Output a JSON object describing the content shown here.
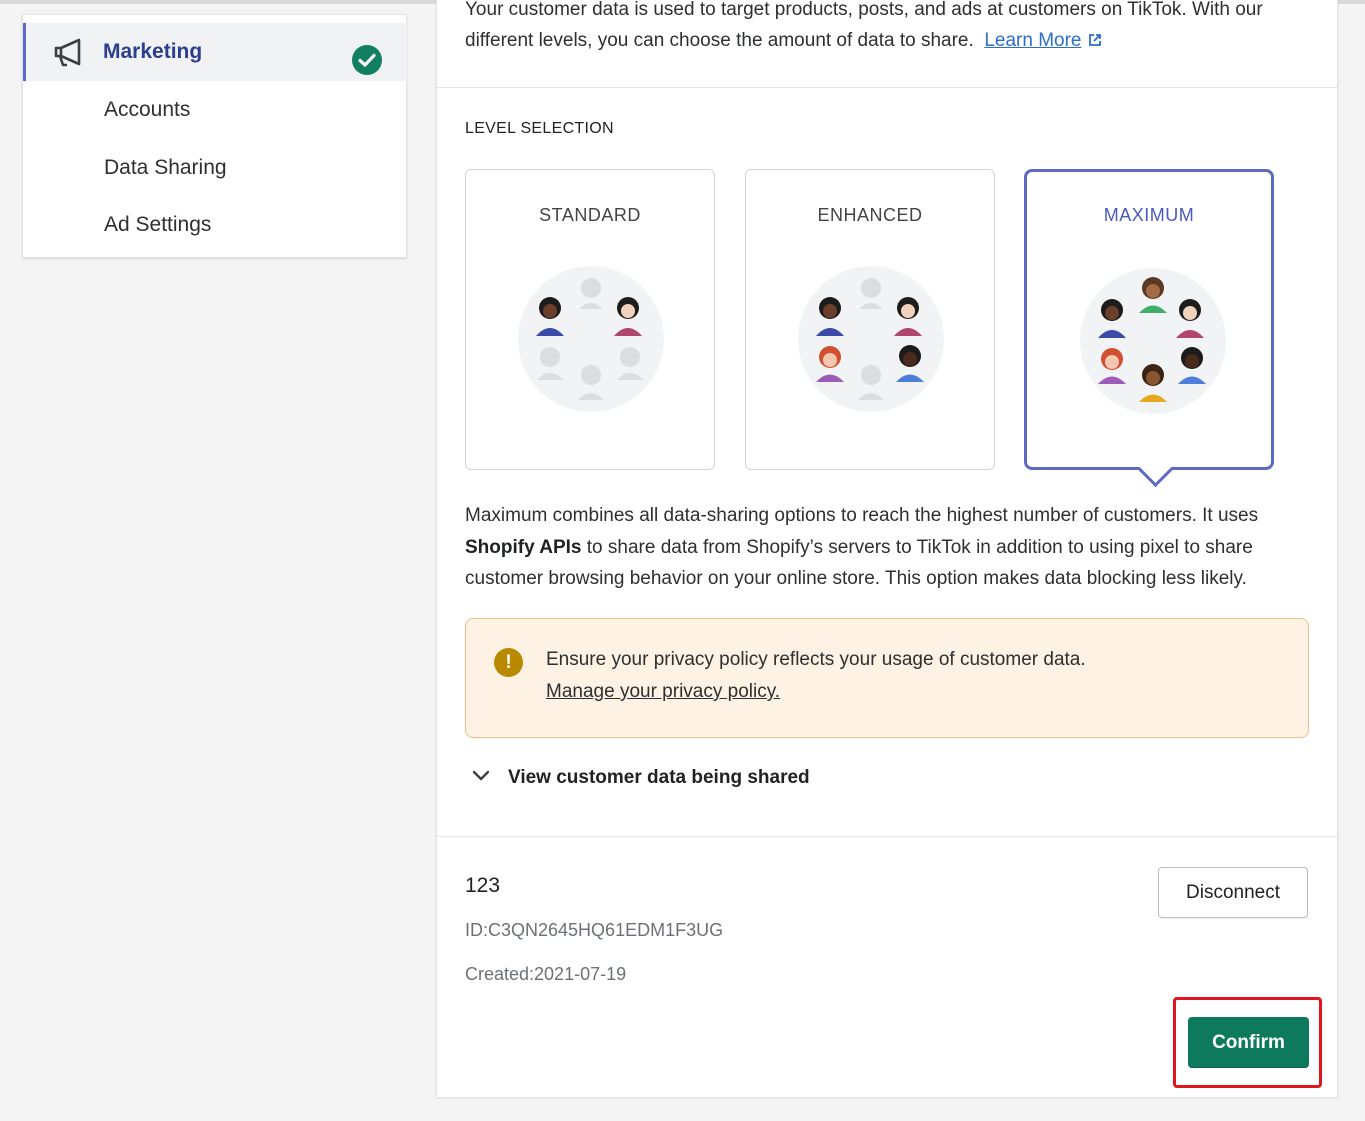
{
  "sidebar": {
    "items": [
      {
        "label": "Marketing",
        "icon": "megaphone-icon",
        "active": true,
        "completed": true
      },
      {
        "label": "Accounts"
      },
      {
        "label": "Data Sharing"
      },
      {
        "label": "Ad Settings"
      }
    ]
  },
  "intro": {
    "text": "Your customer data is used to target products, posts, and ads at customers on TikTok. With our different levels, you can choose the amount of data to share.",
    "link": "Learn More",
    "link_icon": "external-link-icon"
  },
  "levels": {
    "title": "LEVEL SELECTION",
    "options": [
      {
        "label": "STANDARD",
        "selected": false
      },
      {
        "label": "ENHANCED",
        "selected": false
      },
      {
        "label": "MAXIMUM",
        "selected": true
      }
    ]
  },
  "description": {
    "pre": "Maximum combines all data-sharing options to reach the highest number of customers. It uses ",
    "bold": "Shopify APIs",
    "post": " to share data from Shopify’s servers to TikTok in addition to using pixel to share customer browsing behavior on your online store. This option makes data blocking less likely."
  },
  "banner": {
    "text": "Ensure your privacy policy reflects your usage of customer data.",
    "link": "Manage your privacy policy.",
    "icon": "warning-icon",
    "icon_glyph": "!"
  },
  "toggle": {
    "label": "View customer data being shared",
    "icon": "chevron-down-icon"
  },
  "account": {
    "name": "123",
    "id": "ID:C3QN2645HQ61EDM1F3UG",
    "created": "Created:2021-07-19"
  },
  "buttons": {
    "disconnect": "Disconnect",
    "confirm": "Confirm"
  },
  "colors": {
    "accent": "#5c6ac4",
    "primary": "#0e7a5d",
    "warning_bg": "#fdf2e3",
    "highlight": "#e0151d",
    "success": "#118061"
  }
}
